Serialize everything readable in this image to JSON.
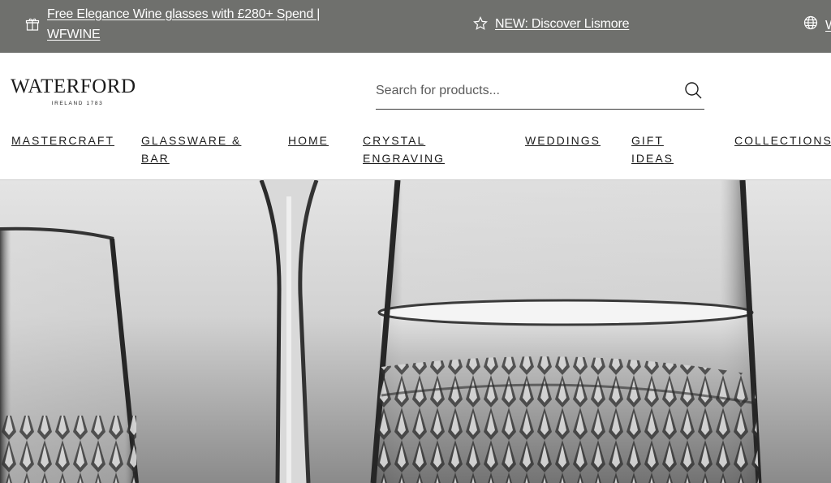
{
  "promo_bar": {
    "item1": {
      "icon": "gift-icon",
      "text": "Free Elegance Wine glasses with £280+ Spend | WFWINE"
    },
    "item2": {
      "icon": "star-icon",
      "text": "NEW: Discover Lismore"
    },
    "item3": {
      "icon": "globe-icon",
      "text": "W"
    }
  },
  "header": {
    "logo_text": "WATERFORD",
    "logo_subtext": "IRELAND 1783",
    "search": {
      "placeholder": "Search for products...",
      "icon": "search-icon"
    }
  },
  "nav": {
    "items": [
      {
        "label": "MASTERCRAFT"
      },
      {
        "label": "GLASSWARE & BAR"
      },
      {
        "label": "HOME"
      },
      {
        "label": "CRYSTAL ENGRAVING"
      },
      {
        "label": "WEDDINGS"
      },
      {
        "label": "GIFT IDEAS"
      },
      {
        "label": "COLLECTIONS"
      }
    ]
  },
  "colors": {
    "promo_bg": "#6f706d",
    "text": "#1c1c1c"
  }
}
